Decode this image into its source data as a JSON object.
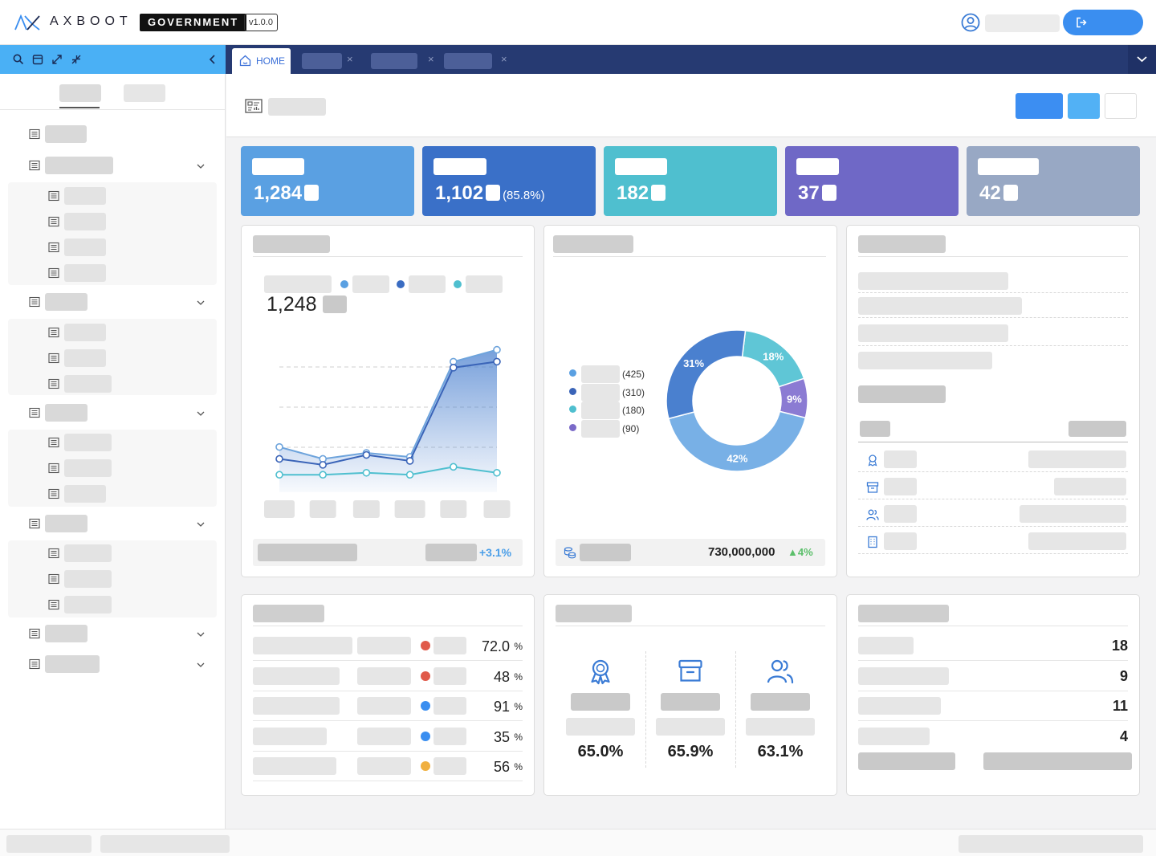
{
  "header": {
    "brand": "AXBOOT",
    "edition": "GOVERNMENT",
    "version": "v1.0.0"
  },
  "tabs": {
    "home_label": "HOME",
    "close_glyph": "×"
  },
  "stats": [
    {
      "value": "1,284",
      "percent": ""
    },
    {
      "value": "1,102",
      "percent": "(85.8%)"
    },
    {
      "value": "182",
      "percent": ""
    },
    {
      "value": "37",
      "percent": ""
    },
    {
      "value": "42",
      "percent": ""
    }
  ],
  "trend": {
    "total": "1,248",
    "change": "+3.1%"
  },
  "donut": {
    "legend_values": [
      "(425)",
      "(310)",
      "(180)",
      "(90)"
    ],
    "slices": [
      {
        "percent": 42,
        "label": "42%",
        "color": "#78b0e6"
      },
      {
        "percent": 31,
        "label": "31%",
        "color": "#4a80cf"
      },
      {
        "percent": 18,
        "label": "18%",
        "color": "#5fc6d6"
      },
      {
        "percent": 9,
        "label": "9%",
        "color": "#8b7bd3"
      }
    ],
    "budget": "730,000,000",
    "budget_change": "▲4%"
  },
  "rates": [
    {
      "value": "72.0",
      "unit": "%",
      "dot": "#e05a4a"
    },
    {
      "value": "48",
      "unit": "%",
      "dot": "#e05a4a"
    },
    {
      "value": "91",
      "unit": "%",
      "dot": "#3a8ef0"
    },
    {
      "value": "35",
      "unit": "%",
      "dot": "#3a8ef0"
    },
    {
      "value": "56",
      "unit": "%",
      "dot": "#f0b040"
    }
  ],
  "kpis": [
    {
      "icon": "award-icon",
      "value": "65.0%"
    },
    {
      "icon": "archive-icon",
      "value": "65.9%"
    },
    {
      "icon": "users-icon",
      "value": "63.1%"
    }
  ],
  "counts": [
    "18",
    "9",
    "11",
    "4"
  ],
  "colors": {
    "stat1": "#5aa0e2",
    "stat2": "#3a70c8",
    "stat3": "#4fbfcf",
    "stat4": "#6f68c6",
    "stat5": "#98a8c4",
    "accent": "#3a8ef0",
    "tabbar": "#263a72",
    "sidebar_toolbar": "#4ab0f5"
  },
  "chart_data": {
    "type": "line",
    "categories": [
      "",
      "",
      "",
      "",
      "",
      ""
    ],
    "series": [
      {
        "values": [
          620,
          560,
          590,
          570,
          1050,
          1110
        ]
      },
      {
        "values": [
          560,
          530,
          580,
          550,
          1020,
          1050
        ]
      },
      {
        "values": [
          480,
          480,
          490,
          480,
          520,
          490
        ]
      }
    ],
    "ylim": [
      400,
      1250
    ],
    "grid": true
  }
}
